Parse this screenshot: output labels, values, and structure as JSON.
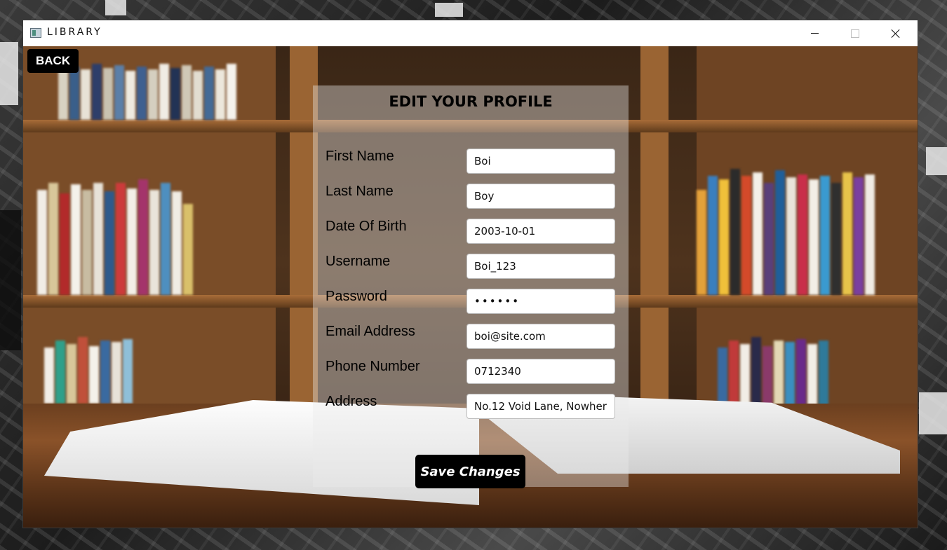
{
  "window": {
    "title": "LIBRARY"
  },
  "nav": {
    "back_label": "BACK"
  },
  "form": {
    "title": "EDIT YOUR PROFILE",
    "fields": [
      {
        "label": "First Name",
        "value": "Boi"
      },
      {
        "label": "Last Name",
        "value": "Boy"
      },
      {
        "label": "Date Of Birth",
        "value": "2003-10-01"
      },
      {
        "label": "Username",
        "value": "Boi_123"
      },
      {
        "label": "Password",
        "value": "••••••"
      },
      {
        "label": "Email Address",
        "value": "boi@site.com"
      },
      {
        "label": "Phone Number",
        "value": "0712340"
      },
      {
        "label": "Address",
        "value": "No.12 Void Lane, Nowher"
      }
    ],
    "save_label": "Save Changes"
  },
  "colors": {
    "button_bg": "#000000",
    "button_text": "#ffffff"
  },
  "icons": [
    "app-icon",
    "minimize-icon",
    "maximize-icon",
    "close-icon"
  ]
}
